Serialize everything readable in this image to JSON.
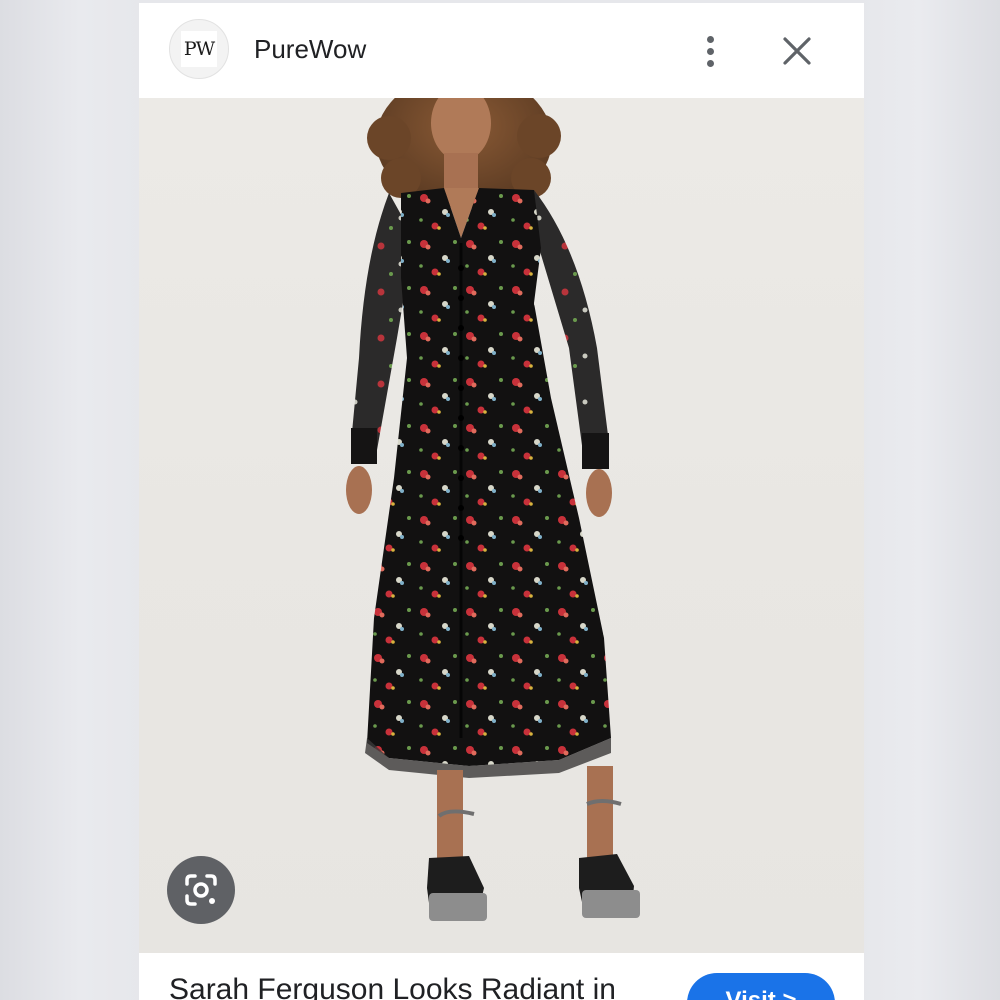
{
  "header": {
    "source_logo_text": "PW",
    "source_name": "PureWow",
    "icons": {
      "more": "more-vert-icon",
      "close": "close-icon"
    }
  },
  "image": {
    "subject": "photo",
    "lens_icon": "google-lens-icon"
  },
  "footer": {
    "headline": "Sarah Ferguson Looks Radiant in",
    "visit_label": "Visit >"
  },
  "colors": {
    "accent": "#1a73e8",
    "icon_gray": "#5f6368",
    "text": "#202124"
  }
}
